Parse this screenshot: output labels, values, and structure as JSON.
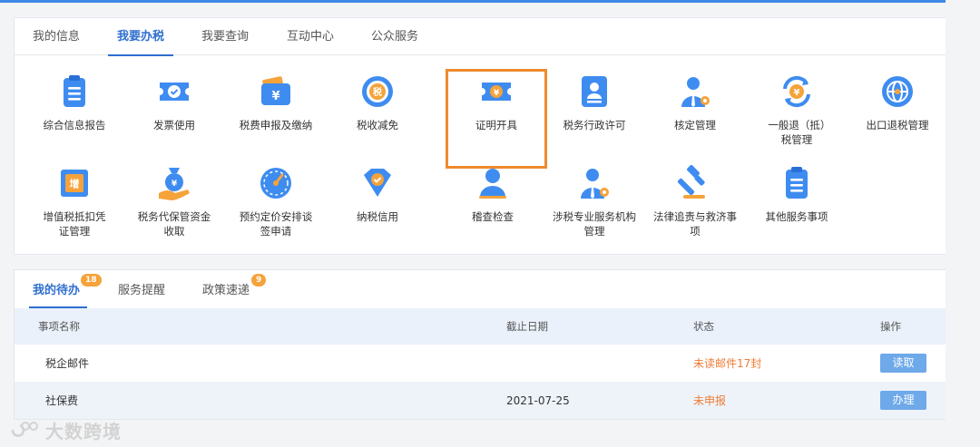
{
  "top_tabs": [
    "我的信息",
    "我要办税",
    "我要查询",
    "互动中心",
    "公众服务"
  ],
  "active_top_tab": "我要办税",
  "services": [
    {
      "label": "综合信息报告",
      "icon": "clipboard-report-icon"
    },
    {
      "label": "发票使用",
      "icon": "invoice-ticket-icon"
    },
    {
      "label": "税费申报及缴纳",
      "icon": "yuan-wallet-icon"
    },
    {
      "label": "税收减免",
      "icon": "tax-reduction-icon"
    },
    {
      "label": "证明开具",
      "icon": "certificate-ticket-icon"
    },
    {
      "label": "税务行政许可",
      "icon": "license-id-icon"
    },
    {
      "label": "核定管理",
      "icon": "officer-gear-icon"
    },
    {
      "label": "一般退（抵）税管理",
      "icon": "refund-yuan-icon"
    },
    {
      "label": "出口退税管理",
      "icon": "globe-icon"
    },
    {
      "label": "增值税抵扣凭证管理",
      "icon": "vat-voucher-icon"
    },
    {
      "label": "税务代保管资金收取",
      "icon": "money-bag-hand-icon"
    },
    {
      "label": "预约定价安排谈签申请",
      "icon": "gauge-icon"
    },
    {
      "label": "纳税信用",
      "icon": "credit-diamond-icon"
    },
    {
      "label": "稽查检查",
      "icon": "inspector-icon"
    },
    {
      "label": "涉税专业服务机构管理",
      "icon": "agency-gear-icon"
    },
    {
      "label": "法律追责与救济事项",
      "icon": "gavel-icon"
    },
    {
      "label": "其他服务事项",
      "icon": "list-icon"
    }
  ],
  "highlighted_service": "证明开具",
  "bottom_tabs": [
    {
      "label": "我的待办",
      "badge": "18"
    },
    {
      "label": "服务提醒",
      "badge": ""
    },
    {
      "label": "政策速递",
      "badge": "9"
    }
  ],
  "table": {
    "headers": [
      "事项名称",
      "截止日期",
      "状态",
      "操作"
    ],
    "rows": [
      {
        "name": "税企邮件",
        "date": "",
        "status": "未读邮件17封",
        "action": "读取"
      },
      {
        "name": "社保费",
        "date": "2021-07-25",
        "status": "未申报",
        "action": "办理"
      }
    ]
  },
  "watermark": "大数跨境",
  "colors": {
    "primary": "#2f6fcf",
    "icon_blue": "#3f8cf0",
    "highlight": "#ee8a2e",
    "badge": "#f5a33a",
    "status": "#ef7b34"
  }
}
